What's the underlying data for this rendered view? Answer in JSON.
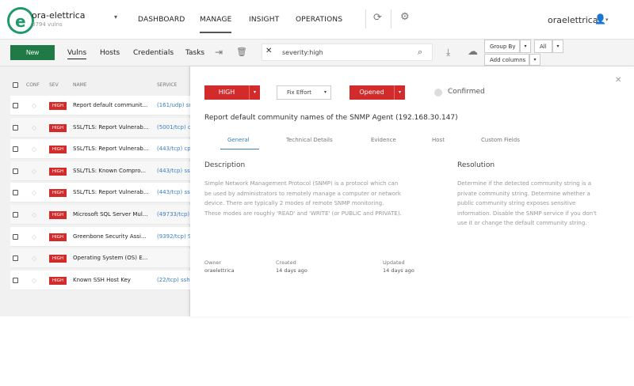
{
  "header": {
    "org_name": "ora-elettrica",
    "org_sub": "3794 vulns",
    "nav": [
      "DASHBOARD",
      "MANAGE",
      "INSIGHT",
      "OPERATIONS"
    ],
    "active_nav": "MANAGE",
    "user_name": "oraelettrica"
  },
  "toolbar": {
    "new_label": "New",
    "tabs": [
      "Vulns",
      "Hosts",
      "Credentials",
      "Tasks"
    ],
    "active_tab": "Vulns",
    "search_value": "severity:high",
    "group_by_label": "Group By",
    "all_label": "All",
    "add_columns_label": "Add columns"
  },
  "list": {
    "headers": [
      "CONF",
      "SEV",
      "NAME",
      "SERVICE"
    ],
    "rows": [
      {
        "sev": "HIGH",
        "name": "Report default communit...",
        "service": "(161/udp) sn"
      },
      {
        "sev": "HIGH",
        "name": "SSL/TLS: Report Vulnerab...",
        "service": "(5001/tcp) c"
      },
      {
        "sev": "HIGH",
        "name": "SSL/TLS: Report Vulnerab...",
        "service": "(443/tcp) cp"
      },
      {
        "sev": "HIGH",
        "name": "SSL/TLS: Known Compro...",
        "service": "(443/tcp) ss"
      },
      {
        "sev": "HIGH",
        "name": "SSL/TLS: Report Vulnerab...",
        "service": "(443/tcp) ss"
      },
      {
        "sev": "HIGH",
        "name": "Microsoft SQL Server Mul...",
        "service": "(49733/tcp)"
      },
      {
        "sev": "HIGH",
        "name": "Greenbone Security Assi...",
        "service": "(9392/tcp) S"
      },
      {
        "sev": "HIGH",
        "name": "Operating System (OS) E...",
        "service": ""
      },
      {
        "sev": "HIGH",
        "name": "Known SSH Host Key",
        "service": "(22/tcp) ssh"
      }
    ]
  },
  "detail": {
    "severity": "HIGH",
    "effort": "Fix Effort",
    "status": "Opened",
    "confirmed_label": "Confirmed",
    "title": "Report default community names of the SNMP Agent (192.168.30.147)",
    "tabs": [
      "General",
      "Technical Details",
      "Evidence",
      "Host",
      "Custom Fields"
    ],
    "active_tab": "General",
    "description_title": "Description",
    "description_lines": [
      "Simple Network Management Protocol (SNMP) is a protocol which can",
      "be used by administrators to remotely manage a computer or network",
      "device. There are typically 2 modes of remote SNMP monitoring.",
      "These modes are roughly 'READ' and 'WRITE' (or PUBLIC and PRIVATE)."
    ],
    "resolution_title": "Resolution",
    "resolution_lines": [
      "Determine if the detected community string is a",
      "private community string. Determine whether a",
      "public community string exposes sensitive",
      "information. Disable the SNMP service if you don't",
      "use it or change the default community string."
    ],
    "owner_label": "Owner",
    "owner_value": "oraelettrica",
    "created_label": "Created",
    "created_value": "14 days ago",
    "updated_label": "Updated",
    "updated_value": "14 days ago"
  },
  "colors": {
    "brand_green": "#1f9a6a",
    "new_button": "#1f7a46",
    "severity_red": "#d22b2b",
    "service_link": "#3a7fc1"
  }
}
